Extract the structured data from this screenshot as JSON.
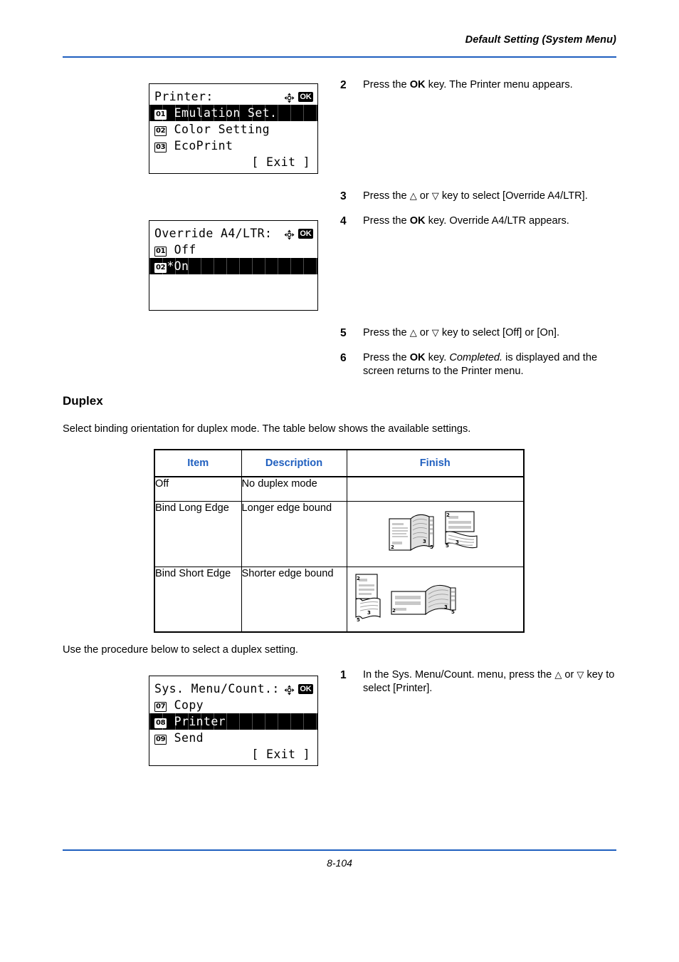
{
  "header": {
    "title": "Default Setting (System Menu)",
    "rule_color": "#1f5fbf"
  },
  "footer": {
    "page_number": "8-104"
  },
  "lcd_printer_menu": {
    "title": "Printer:",
    "dpad_icon": "dpad-icon",
    "ok_icon": "OK",
    "rows": [
      {
        "badge": "01",
        "label": "Emulation Set.",
        "selected": true
      },
      {
        "badge": "02",
        "label": "Color Setting",
        "selected": false
      },
      {
        "badge": "03",
        "label": "EcoPrint",
        "selected": false
      }
    ],
    "exit": "[  Exit   ]"
  },
  "lcd_override": {
    "title": "Override A4/LTR:",
    "dpad_icon": "dpad-icon",
    "ok_icon": "OK",
    "rows": [
      {
        "badge": "01",
        "label": "Off",
        "selected": false
      },
      {
        "badge": "02",
        "label": "*On",
        "selected": true
      }
    ]
  },
  "lcd_sysmenu": {
    "title": "Sys. Menu/Count.:",
    "dpad_icon": "dpad-icon",
    "ok_icon": "OK",
    "rows": [
      {
        "badge": "07",
        "label": "Copy",
        "selected": false
      },
      {
        "badge": "08",
        "label": "Printer",
        "selected": true
      },
      {
        "badge": "09",
        "label": "Send",
        "selected": false
      }
    ],
    "exit": "[  Exit   ]"
  },
  "steps": {
    "s2_num": "2",
    "s2_a": "Press the ",
    "s2_ok": "OK",
    "s2_b": " key. The Printer menu appears.",
    "s3_num": "3",
    "s3_a": "Press the ",
    "s3_up": "△",
    "s3_or": " or ",
    "s3_down": "▽",
    "s3_b": " key to select [Override A4/LTR].",
    "s4_num": "4",
    "s4_a": "Press the ",
    "s4_ok": "OK",
    "s4_b": " key. Override A4/LTR appears.",
    "s5_num": "5",
    "s5_a": "Press the ",
    "s5_up": "△",
    "s5_or": " or ",
    "s5_down": "▽",
    "s5_b": " key to select [Off] or [On].",
    "s6_num": "6",
    "s6_a": "Press the ",
    "s6_ok": "OK",
    "s6_b": " key. ",
    "s6_italic": "Completed.",
    "s6_c": " is displayed and the screen returns to the Printer menu.",
    "s1_num": "1",
    "s1_a": "In the Sys. Menu/Count. menu, press the ",
    "s1_up": "△",
    "s1_or": " or ",
    "s1_down": "▽",
    "s1_b": " key to select [Printer]."
  },
  "section": {
    "heading": "Duplex",
    "intro": "Select binding orientation for duplex mode. The table below shows the available settings.",
    "outro": "Use the procedure below to select a duplex setting."
  },
  "table": {
    "accent_color": "#1f5fbf",
    "headers": [
      "Item",
      "Description",
      "Finish"
    ],
    "rows": [
      {
        "item": "Off",
        "description": "No duplex mode",
        "finish": ""
      },
      {
        "item": "Bind Long Edge",
        "description": "Longer edge bound",
        "finish": "long-edge-duplex-illustration"
      },
      {
        "item": "Bind Short Edge",
        "description": "Shorter edge bound",
        "finish": "short-edge-duplex-illustration"
      }
    ],
    "illustration_page_labels": [
      "2",
      "3",
      "5"
    ]
  }
}
